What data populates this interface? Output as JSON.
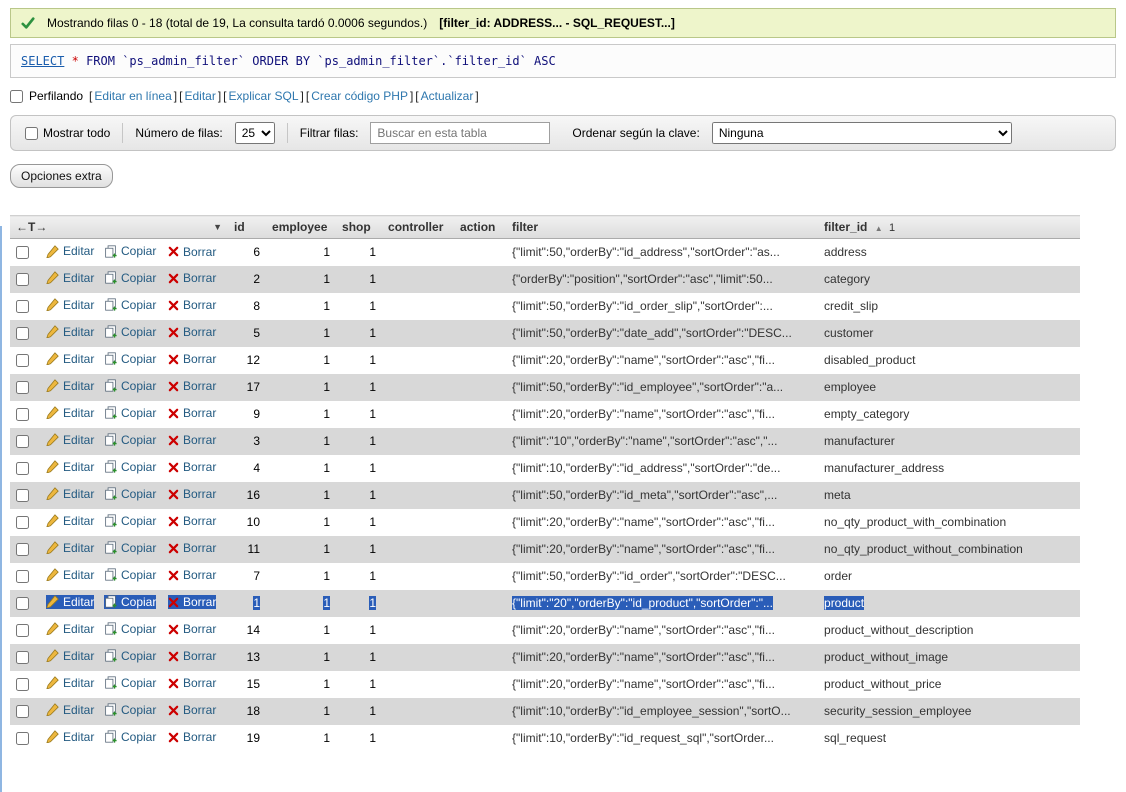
{
  "message_bar": {
    "text": "Mostrando filas 0 - 18 (total de 19, La consulta tardó 0.0006 segundos.)",
    "text_bold": "[filter_id: ADDRESS... - SQL_REQUEST...]"
  },
  "sql": {
    "select": "SELECT",
    "star": "*",
    "from": "FROM",
    "table_ident": "`ps_admin_filter`",
    "order_by": "ORDER BY",
    "order_ident": "`ps_admin_filter`.`filter_id`",
    "direction": "ASC"
  },
  "profiling": {
    "label": "Perfilando",
    "bracket_open": "[",
    "bracket_close": "]",
    "links": [
      "Editar en línea",
      "Editar",
      "Explicar SQL",
      "Crear código PHP",
      "Actualizar"
    ]
  },
  "filter_bar": {
    "show_all_label": "Mostrar todo",
    "rows_label": "Número de filas:",
    "rows_value": "25",
    "filter_label": "Filtrar filas:",
    "filter_placeholder": "Buscar en esta tabla",
    "sort_label": "Ordenar según la clave:",
    "sort_value": "Ninguna"
  },
  "extra_options_label": "Opciones extra",
  "table": {
    "header_options": "←T→",
    "columns": {
      "id": "id",
      "employee": "employee",
      "shop": "shop",
      "controller": "controller",
      "action": "action",
      "filter": "filter",
      "filter_id": "filter_id"
    },
    "sort": {
      "column": "filter_id",
      "direction": "asc",
      "arrow": "▲",
      "index": "1"
    },
    "options_caret": "▼",
    "action_labels": {
      "edit": "Editar",
      "copy": "Copiar",
      "del": "Borrar"
    },
    "rows": [
      {
        "id": "6",
        "employee": "1",
        "shop": "1",
        "controller": "",
        "action": "",
        "filter": "{\"limit\":50,\"orderBy\":\"id_address\",\"sortOrder\":\"as...",
        "filter_id": "address",
        "selected": false
      },
      {
        "id": "2",
        "employee": "1",
        "shop": "1",
        "controller": "",
        "action": "",
        "filter": "{\"orderBy\":\"position\",\"sortOrder\":\"asc\",\"limit\":50...",
        "filter_id": "category",
        "selected": false
      },
      {
        "id": "8",
        "employee": "1",
        "shop": "1",
        "controller": "",
        "action": "",
        "filter": "{\"limit\":50,\"orderBy\":\"id_order_slip\",\"sortOrder\":...",
        "filter_id": "credit_slip",
        "selected": false
      },
      {
        "id": "5",
        "employee": "1",
        "shop": "1",
        "controller": "",
        "action": "",
        "filter": "{\"limit\":50,\"orderBy\":\"date_add\",\"sortOrder\":\"DESC...",
        "filter_id": "customer",
        "selected": false
      },
      {
        "id": "12",
        "employee": "1",
        "shop": "1",
        "controller": "",
        "action": "",
        "filter": "{\"limit\":20,\"orderBy\":\"name\",\"sortOrder\":\"asc\",\"fi...",
        "filter_id": "disabled_product",
        "selected": false
      },
      {
        "id": "17",
        "employee": "1",
        "shop": "1",
        "controller": "",
        "action": "",
        "filter": "{\"limit\":50,\"orderBy\":\"id_employee\",\"sortOrder\":\"a...",
        "filter_id": "employee",
        "selected": false
      },
      {
        "id": "9",
        "employee": "1",
        "shop": "1",
        "controller": "",
        "action": "",
        "filter": "{\"limit\":20,\"orderBy\":\"name\",\"sortOrder\":\"asc\",\"fi...",
        "filter_id": "empty_category",
        "selected": false
      },
      {
        "id": "3",
        "employee": "1",
        "shop": "1",
        "controller": "",
        "action": "",
        "filter": "{\"limit\":\"10\",\"orderBy\":\"name\",\"sortOrder\":\"asc\",\"...",
        "filter_id": "manufacturer",
        "selected": false
      },
      {
        "id": "4",
        "employee": "1",
        "shop": "1",
        "controller": "",
        "action": "",
        "filter": "{\"limit\":10,\"orderBy\":\"id_address\",\"sortOrder\":\"de...",
        "filter_id": "manufacturer_address",
        "selected": false
      },
      {
        "id": "16",
        "employee": "1",
        "shop": "1",
        "controller": "",
        "action": "",
        "filter": "{\"limit\":50,\"orderBy\":\"id_meta\",\"sortOrder\":\"asc\",...",
        "filter_id": "meta",
        "selected": false
      },
      {
        "id": "10",
        "employee": "1",
        "shop": "1",
        "controller": "",
        "action": "",
        "filter": "{\"limit\":20,\"orderBy\":\"name\",\"sortOrder\":\"asc\",\"fi...",
        "filter_id": "no_qty_product_with_combination",
        "selected": false
      },
      {
        "id": "11",
        "employee": "1",
        "shop": "1",
        "controller": "",
        "action": "",
        "filter": "{\"limit\":20,\"orderBy\":\"name\",\"sortOrder\":\"asc\",\"fi...",
        "filter_id": "no_qty_product_without_combination",
        "selected": false
      },
      {
        "id": "7",
        "employee": "1",
        "shop": "1",
        "controller": "",
        "action": "",
        "filter": "{\"limit\":50,\"orderBy\":\"id_order\",\"sortOrder\":\"DESC...",
        "filter_id": "order",
        "selected": false
      },
      {
        "id": "1",
        "employee": "1",
        "shop": "1",
        "controller": "",
        "action": "",
        "filter": "{\"limit\":\"20\",\"orderBy\":\"id_product\",\"sortOrder\":\"...",
        "filter_id": "product",
        "selected": true
      },
      {
        "id": "14",
        "employee": "1",
        "shop": "1",
        "controller": "",
        "action": "",
        "filter": "{\"limit\":20,\"orderBy\":\"name\",\"sortOrder\":\"asc\",\"fi...",
        "filter_id": "product_without_description",
        "selected": false
      },
      {
        "id": "13",
        "employee": "1",
        "shop": "1",
        "controller": "",
        "action": "",
        "filter": "{\"limit\":20,\"orderBy\":\"name\",\"sortOrder\":\"asc\",\"fi...",
        "filter_id": "product_without_image",
        "selected": false
      },
      {
        "id": "15",
        "employee": "1",
        "shop": "1",
        "controller": "",
        "action": "",
        "filter": "{\"limit\":20,\"orderBy\":\"name\",\"sortOrder\":\"asc\",\"fi...",
        "filter_id": "product_without_price",
        "selected": false
      },
      {
        "id": "18",
        "employee": "1",
        "shop": "1",
        "controller": "",
        "action": "",
        "filter": "{\"limit\":10,\"orderBy\":\"id_employee_session\",\"sortO...",
        "filter_id": "security_session_employee",
        "selected": false
      },
      {
        "id": "19",
        "employee": "1",
        "shop": "1",
        "controller": "",
        "action": "",
        "filter": "{\"limit\":10,\"orderBy\":\"id_request_sql\",\"sortOrder...",
        "filter_id": "sql_request",
        "selected": false
      }
    ]
  }
}
